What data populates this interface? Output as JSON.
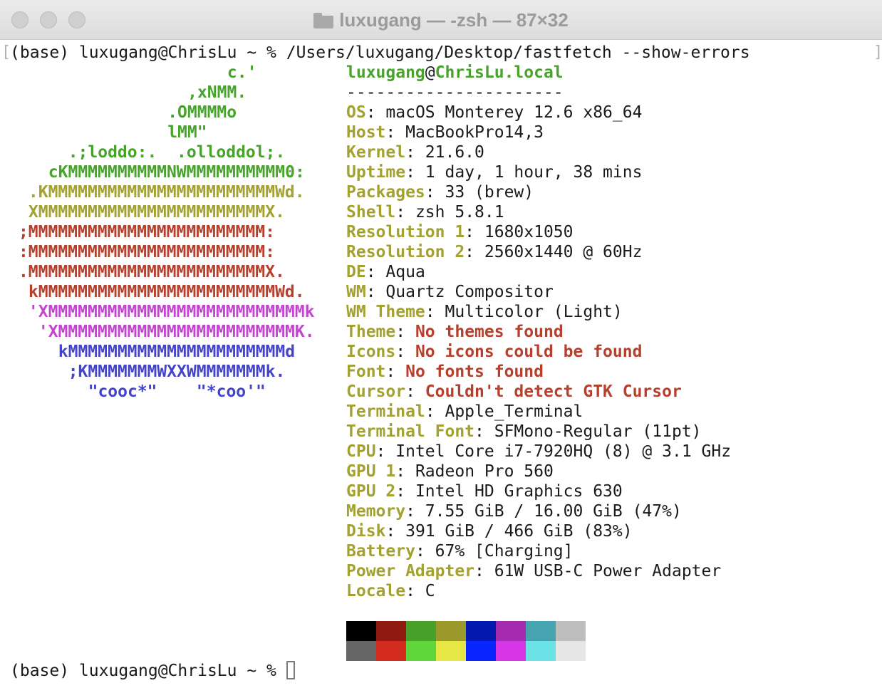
{
  "window": {
    "title": "luxugang — -zsh — 87×32",
    "folder_icon": "folder-icon",
    "traffic_lights": [
      "close-button",
      "minimize-button",
      "zoom-button"
    ]
  },
  "terminal": {
    "command_prompt": "(base) luxugang@ChrisLu ~ % ",
    "command": "/Users/luxugang/Desktop/fastfetch --show-errors",
    "bracket_left": "[",
    "bracket_right": "]",
    "final_prompt": "(base) luxugang@ChrisLu ~ % "
  },
  "logo": {
    "lines": [
      {
        "text": "c.'",
        "color": "green",
        "col": 22
      },
      {
        "text": ",xNMM.",
        "color": "green",
        "col": 18
      },
      {
        "text": ".OMMMMo",
        "color": "green",
        "col": 16
      },
      {
        "text": "lMM\"",
        "color": "green",
        "col": 16
      },
      {
        "text": ".;loddo:.  .olloddol;.",
        "color": "green",
        "col": 6
      },
      {
        "text": "cKMMMMMMMMMMNWMMMMMMMMMM0:",
        "color": "green",
        "col": 4
      },
      {
        "text": ".KMMMMMMMMMMMMMMMMMMMMMMMWd.",
        "color": "yellow",
        "col": 2
      },
      {
        "text": "XMMMMMMMMMMMMMMMMMMMMMMMX.",
        "color": "yellow",
        "col": 2
      },
      {
        "text": ";MMMMMMMMMMMMMMMMMMMMMMMM:",
        "color": "red",
        "col": 1
      },
      {
        "text": ":MMMMMMMMMMMMMMMMMMMMMMMM:",
        "color": "red",
        "col": 1
      },
      {
        "text": ".MMMMMMMMMMMMMMMMMMMMMMMMX.",
        "color": "red",
        "col": 1
      },
      {
        "text": "kMMMMMMMMMMMMMMMMMMMMMMMMWd.",
        "color": "red",
        "col": 2
      },
      {
        "text": "'XMMMMMMMMMMMMMMMMMMMMMMMMMMk",
        "color": "magenta",
        "col": 2
      },
      {
        "text": "'XMMMMMMMMMMMMMMMMMMMMMMMMK.",
        "color": "magenta",
        "col": 3
      },
      {
        "text": "kMMMMMMMMMMMMMMMMMMMMMMd",
        "color": "blue",
        "col": 5
      },
      {
        "text": ";KMMMMMMMWXXWMMMMMMMk.",
        "color": "blue",
        "col": 6
      },
      {
        "text": "\"cooc*\"    \"*coo'\"",
        "color": "blue",
        "col": 8
      }
    ]
  },
  "info": {
    "user": "luxugang",
    "at": "@",
    "host": "ChrisLu.local",
    "separator": "----------------------",
    "rows": [
      {
        "label": "OS",
        "value": "macOS Monterey 12.6 x86_64",
        "error": false
      },
      {
        "label": "Host",
        "value": "MacBookPro14,3",
        "error": false
      },
      {
        "label": "Kernel",
        "value": "21.6.0",
        "error": false
      },
      {
        "label": "Uptime",
        "value": "1 day, 1 hour, 38 mins",
        "error": false
      },
      {
        "label": "Packages",
        "value": "33 (brew)",
        "error": false
      },
      {
        "label": "Shell",
        "value": "zsh 5.8.1",
        "error": false
      },
      {
        "label": "Resolution 1",
        "value": "1680x1050",
        "error": false
      },
      {
        "label": "Resolution 2",
        "value": "2560x1440 @ 60Hz",
        "error": false
      },
      {
        "label": "DE",
        "value": "Aqua",
        "error": false
      },
      {
        "label": "WM",
        "value": "Quartz Compositor",
        "error": false
      },
      {
        "label": "WM Theme",
        "value": "Multicolor (Light)",
        "error": false
      },
      {
        "label": "Theme",
        "value": "No themes found",
        "error": true
      },
      {
        "label": "Icons",
        "value": "No icons could be found",
        "error": true
      },
      {
        "label": "Font",
        "value": "No fonts found",
        "error": true
      },
      {
        "label": "Cursor",
        "value": "Couldn't detect GTK Cursor",
        "error": true
      },
      {
        "label": "Terminal",
        "value": "Apple_Terminal",
        "error": false
      },
      {
        "label": "Terminal Font",
        "value": "SFMono-Regular (11pt)",
        "error": false
      },
      {
        "label": "CPU",
        "value": "Intel Core i7-7920HQ (8) @ 3.1 GHz",
        "error": false
      },
      {
        "label": "GPU 1",
        "value": "Radeon Pro 560",
        "error": false
      },
      {
        "label": "GPU 2",
        "value": "Intel HD Graphics 630",
        "error": false
      },
      {
        "label": "Memory",
        "value": "7.55 GiB / 16.00 GiB (47%)",
        "error": false
      },
      {
        "label": "Disk",
        "value": "391 GiB / 466 GiB (83%)",
        "error": false
      },
      {
        "label": "Battery",
        "value": "67% [Charging]",
        "error": false
      },
      {
        "label": "Power Adapter",
        "value": "61W USB-C Power Adapter",
        "error": false
      },
      {
        "label": "Locale",
        "value": "C",
        "error": false
      }
    ]
  },
  "colors": {
    "top_row": [
      "#000000",
      "#8f1a12",
      "#46a02a",
      "#9b992a",
      "#0419b0",
      "#a52bae",
      "#45a4b0",
      "#bebebe"
    ],
    "bottom_row": [
      "#666666",
      "#d42d1f",
      "#5fd63b",
      "#e6e644",
      "#0a26ff",
      "#d636e6",
      "#6be3e6",
      "#e6e6e6"
    ]
  }
}
